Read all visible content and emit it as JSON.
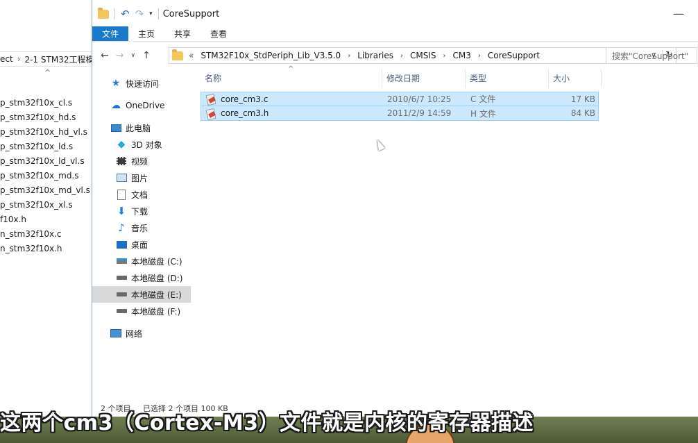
{
  "back_window": {
    "breadcrumb": [
      "ect",
      "2-1 STM32工程模"
    ],
    "files": [
      "p_stm32f10x_cl.s",
      "p_stm32f10x_hd.s",
      "p_stm32f10x_hd_vl.s",
      "p_stm32f10x_ld.s",
      "p_stm32f10x_ld_vl.s",
      "p_stm32f10x_md.s",
      "p_stm32f10x_md_vl.s",
      "p_stm32f10x_xl.s",
      "f10x.h",
      "n_stm32f10x.c",
      "n_stm32f10x.h"
    ]
  },
  "window": {
    "title": "CoreSupport",
    "ribbon_tabs": [
      "文件",
      "主页",
      "共享",
      "查看"
    ],
    "address_prefix": "«",
    "breadcrumb": [
      "STM32F10x_StdPeriph_Lib_V3.5.0",
      "Libraries",
      "CMSIS",
      "CM3",
      "CoreSupport"
    ],
    "search_placeholder": "搜索\"CoreSupport\""
  },
  "navigation": {
    "quick_access": "快速访问",
    "onedrive": "OneDrive",
    "this_pc": "此电脑",
    "pc_items": [
      "3D 对象",
      "视频",
      "图片",
      "文档",
      "下载",
      "音乐",
      "桌面"
    ],
    "drives": [
      "本地磁盘 (C:)",
      "本地磁盘 (D:)",
      "本地磁盘 (E:)",
      "本地磁盘 (F:)"
    ],
    "network": "网络"
  },
  "columns": {
    "name": "名称",
    "date": "修改日期",
    "type": "类型",
    "size": "大小"
  },
  "files": [
    {
      "name": "core_cm3.c",
      "date": "2010/6/7 10:25",
      "type": "C 文件",
      "size": "17 KB"
    },
    {
      "name": "core_cm3.h",
      "date": "2011/2/9 14:59",
      "type": "H 文件",
      "size": "84 KB"
    }
  ],
  "status": {
    "count": "2 个项目",
    "selected": "已选择 2 个项目  100 KB"
  },
  "subtitle": "这两个cm3（Cortex-M3）文件就是内核的寄存器描述",
  "colors": {
    "ribbon_active": "#1979ca",
    "selection_bg": "#cce8ff",
    "selection_border": "#99d1ff",
    "folder": "#f2c75c"
  }
}
